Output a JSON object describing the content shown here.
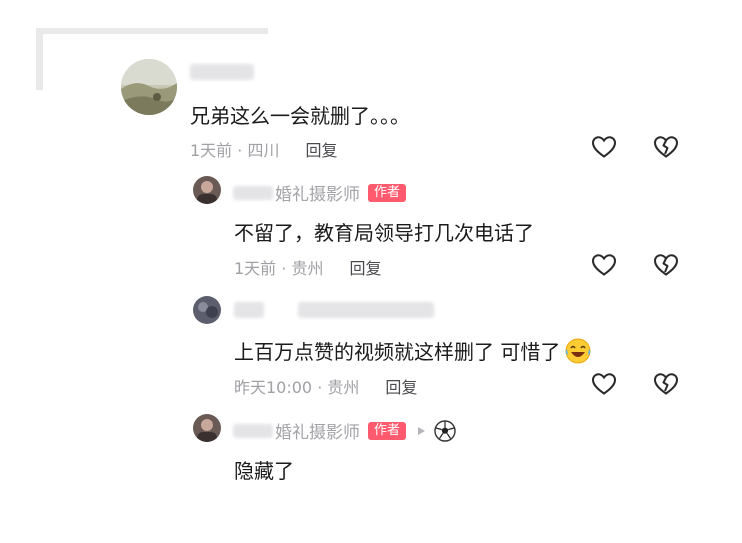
{
  "comments": [
    {
      "name": "",
      "author_badge": "",
      "text": "兄弟这么一会就删了。。。",
      "time_location": "1天前 · 四川",
      "reply_label": "回复"
    },
    {
      "name": "婚礼摄影师",
      "author_badge": "作者",
      "text": "不留了，教育局领导打几次电话了",
      "time_location": "1天前 · 贵州",
      "reply_label": "回复"
    },
    {
      "name": "",
      "author_badge": "",
      "text": "上百万点赞的视频就这样删了 可惜了",
      "time_location": "昨天10:00 · 贵州",
      "reply_label": "回复"
    },
    {
      "name": "婚礼摄影师",
      "author_badge": "作者",
      "text": "隐藏了",
      "time_location": "",
      "reply_label": ""
    }
  ],
  "icons": {
    "like": "heart-outline-icon",
    "dislike": "broken-heart-icon",
    "emoji": "laughing-crying-emoji-icon",
    "soccer": "soccer-ball-icon",
    "reply_indicator": "triangle-right-icon"
  },
  "colors": {
    "author_badge": "#ff5a6e",
    "muted_text": "#a0a0a5",
    "reply_text": "#4b4b4f",
    "body_text": "#1b1b1b"
  }
}
